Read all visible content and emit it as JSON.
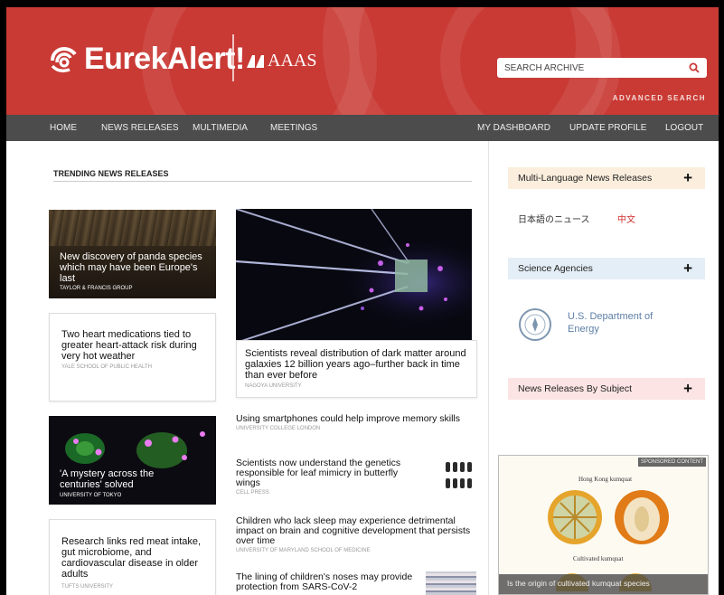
{
  "header": {
    "brand": "EurekAlert!",
    "partner": "AAAS",
    "search_placeholder": "SEARCH ARCHIVE",
    "advanced_search": "ADVANCED SEARCH"
  },
  "nav": {
    "left": [
      "HOME",
      "NEWS RELEASES",
      "MULTIMEDIA",
      "MEETINGS"
    ],
    "right": [
      "MY DASHBOARD",
      "UPDATE PROFILE",
      "LOGOUT"
    ]
  },
  "trending": {
    "title": "TRENDING NEWS RELEASES",
    "panda": {
      "title": "New discovery of panda species which may have been Europe's last",
      "source": "TAYLOR & FRANCIS GROUP"
    },
    "heart": {
      "title": "Two heart medications tied to greater heart-attack risk during very hot weather",
      "source": "YALE SCHOOL OF PUBLIC HEALTH"
    },
    "dark_matter": {
      "title": "Scientists reveal distribution of dark matter around galaxies 12 billion years ago–further back in time than ever before",
      "source": "NAGOYA UNIVERSITY"
    },
    "mystery": {
      "title": "'A mystery across the centuries' solved",
      "source": "UNIVERSITY OF TOKYO"
    },
    "red_meat": {
      "title": "Research links red meat intake, gut microbiome, and cardiovascular disease in older adults",
      "source": "TUFTS UNIVERSITY"
    },
    "smartphones": {
      "title": "Using smartphones could help improve memory skills",
      "source": "UNIVERSITY COLLEGE LONDON"
    },
    "butterfly": {
      "title": "Scientists now understand the genetics responsible for leaf mimicry in butterfly wings",
      "source": "CELL PRESS"
    },
    "sleep": {
      "title": "Children who lack sleep may experience detrimental impact on brain and cognitive development that persists over time",
      "source": "UNIVERSITY OF MARYLAND SCHOOL OF MEDICINE"
    },
    "noses": {
      "title": "The lining of children's noses may provide protection from SARS-CoV-2"
    }
  },
  "sidebar": {
    "multi_language": "Multi-Language News Releases",
    "japanese": "日本語のニュース",
    "chinese": "中文",
    "agencies": "Science Agencies",
    "doe": "U.S. Department of Energy",
    "by_subject": "News Releases By Subject",
    "sponsored": {
      "badge": "SPONSORED CONTENT",
      "heading1": "Hong Kong kumquat",
      "heading2": "Cultivated kumquat",
      "caption": "Is the origin of cultivated kumquat species"
    }
  },
  "colors": {
    "brand_red": "#c93a35",
    "nav": "#4c4c4c",
    "chinese_link": "#d0312d",
    "doe_blue": "#5d7fa6"
  }
}
